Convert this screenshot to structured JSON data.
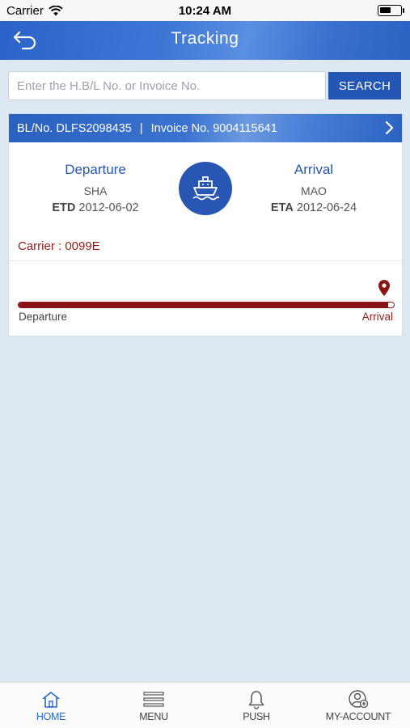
{
  "status_bar": {
    "carrier": "Carrier",
    "time": "10:24 AM"
  },
  "header": {
    "title": "Tracking"
  },
  "search": {
    "placeholder": "Enter the H.B/L No. or Invoice No.",
    "value": "",
    "button_label": "SEARCH"
  },
  "shipment": {
    "bl_label": "BL/No. DLFS2098435",
    "separator": "|",
    "invoice_label": "Invoice No. 9004115641",
    "departure": {
      "heading": "Departure",
      "port": "SHA",
      "date_prefix": "ETD",
      "date": "2012-06-02"
    },
    "arrival": {
      "heading": "Arrival",
      "port": "MAO",
      "date_prefix": "ETA",
      "date": "2012-06-24"
    },
    "carrier_text": "Carrier : 0099E",
    "progress": {
      "fraction": 0.985,
      "start_label": "Departure",
      "end_label": "Arrival"
    }
  },
  "tab_bar": {
    "tabs": [
      {
        "label": "HOME",
        "icon": "home-icon",
        "active": true
      },
      {
        "label": "MENU",
        "icon": "menu-icon",
        "active": false
      },
      {
        "label": "PUSH",
        "icon": "bell-icon",
        "active": false
      },
      {
        "label": "MY-ACCOUNT",
        "icon": "account-icon",
        "active": false
      }
    ]
  },
  "colors": {
    "primary_blue": "#2856b3",
    "accent_red": "#8a1414",
    "background": "#dde8f3",
    "active_tab": "#2a67d0"
  }
}
